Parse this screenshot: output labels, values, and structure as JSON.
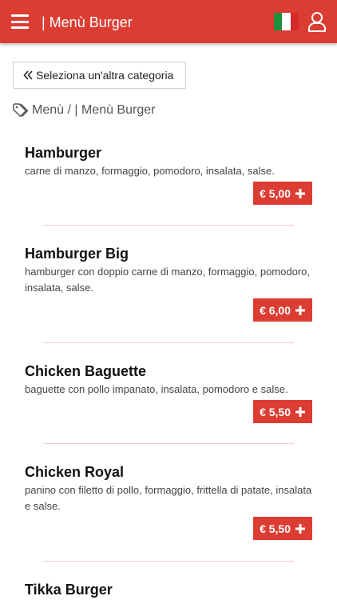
{
  "header": {
    "title": "| Menù Burger",
    "menu_icon": "hamburger-menu-icon",
    "flag": "italy-flag-icon",
    "user_icon": "user-icon",
    "accent_color": "#dc3d33"
  },
  "back_button": {
    "label": "Seleziona un'altra categoria",
    "icon": "double-chevron-left-icon"
  },
  "breadcrumb": {
    "icon": "tag-icon",
    "text": "Menù / | Menù Burger"
  },
  "items": [
    {
      "name": "Hamburger",
      "description": "carne di manzo, formaggio, pomodoro, insalata, salse.",
      "price": "€ 5,00"
    },
    {
      "name": "Hamburger Big",
      "description": "hamburger con doppio carne di manzo, formaggio, pomodoro, insalata, salse.",
      "price": "€ 6,00"
    },
    {
      "name": "Chicken Baguette",
      "description": "baguette con pollo impanato, insalata, pomodoro e salse.",
      "price": "€ 5,50"
    },
    {
      "name": "Chicken Royal",
      "description": "panino con filetto di pollo, formaggio, frittella di patate, insalata e salse.",
      "price": "€ 5,50"
    },
    {
      "name": "Tikka Burger",
      "description": "",
      "price": ""
    }
  ]
}
